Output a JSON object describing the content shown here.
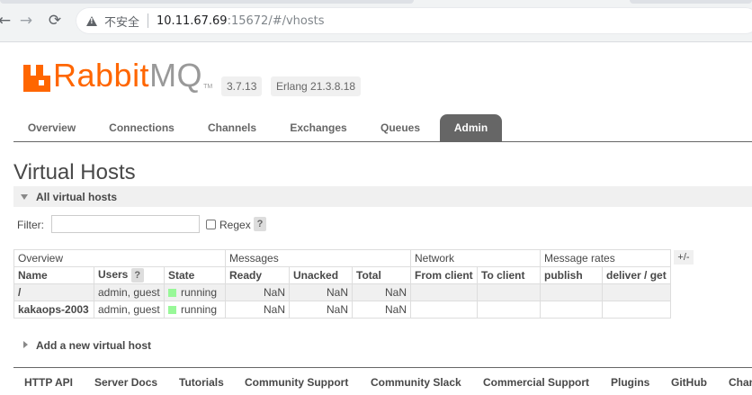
{
  "browser": {
    "insecure_label": "不安全",
    "url_host": "10.11.67.69",
    "url_rest": ":15672/#/vhosts"
  },
  "header": {
    "logo_rabbit": "Rabbit",
    "logo_mq": "MQ",
    "logo_tm": "TM",
    "version": "3.7.13",
    "erlang": "Erlang 21.3.8.18"
  },
  "nav": {
    "items": [
      "Overview",
      "Connections",
      "Channels",
      "Exchanges",
      "Queues",
      "Admin"
    ],
    "active": "Admin"
  },
  "page": {
    "title": "Virtual Hosts",
    "section_title": "All virtual hosts",
    "filter_label": "Filter:",
    "filter_value": "",
    "regex_label": "Regex",
    "help": "?",
    "plusminus": "+/-",
    "add_vhost": "Add a new virtual host"
  },
  "table": {
    "groups": [
      "Overview",
      "Messages",
      "Network",
      "Message rates"
    ],
    "columns": [
      "Name",
      "Users",
      "State",
      "Ready",
      "Unacked",
      "Total",
      "From client",
      "To client",
      "publish",
      "deliver / get"
    ],
    "rows": [
      {
        "name": "/",
        "users": "admin, guest",
        "state": "running",
        "ready": "NaN",
        "unacked": "NaN",
        "total": "NaN",
        "from_client": "",
        "to_client": "",
        "publish": "",
        "deliver_get": ""
      },
      {
        "name": "kakaops-2003",
        "users": "admin, guest",
        "state": "running",
        "ready": "NaN",
        "unacked": "NaN",
        "total": "NaN",
        "from_client": "",
        "to_client": "",
        "publish": "",
        "deliver_get": ""
      }
    ]
  },
  "footer": {
    "links": [
      "HTTP API",
      "Server Docs",
      "Tutorials",
      "Community Support",
      "Community Slack",
      "Commercial Support",
      "Plugins",
      "GitHub",
      "Chan"
    ]
  },
  "colors": {
    "brand": "#ff6600",
    "nav_active_bg": "#666666",
    "running": "#98f898"
  }
}
